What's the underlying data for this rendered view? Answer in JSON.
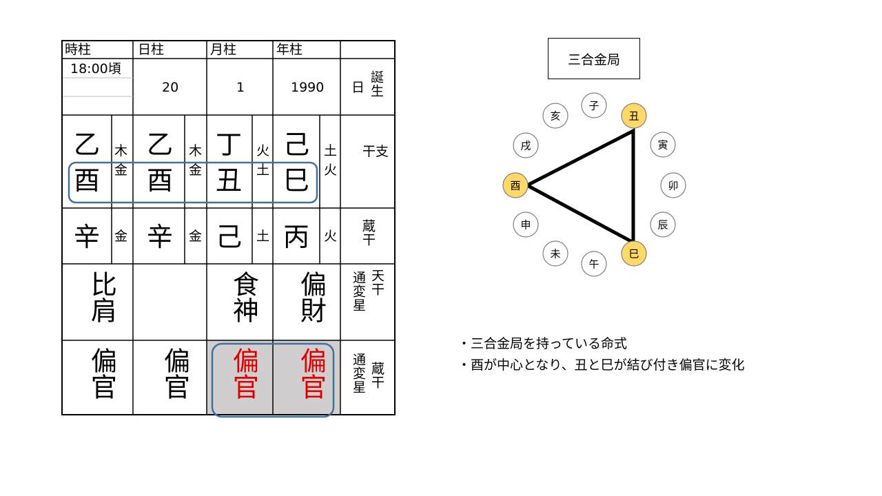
{
  "table": {
    "headers": [
      "時柱",
      "日柱",
      "月柱",
      "年柱"
    ],
    "birth": {
      "time": "18:00頃",
      "day": "20",
      "month": "1",
      "year": "1990",
      "label_a": "日",
      "label_b": "誕生"
    },
    "stems": [
      "乙",
      "乙",
      "丁",
      "己"
    ],
    "stem_elements": [
      "木",
      "木",
      "火",
      "土"
    ],
    "branches": [
      "酉",
      "酉",
      "丑",
      "巳"
    ],
    "branch_elements": [
      "金",
      "金",
      "土",
      "火"
    ],
    "hidden_stems": [
      "辛",
      "辛",
      "己",
      "丙"
    ],
    "hidden_elements": [
      "金",
      "金",
      "土",
      "火"
    ],
    "kanshi_label": "干支",
    "zoukan_label": "蔵干",
    "tenkan_stars": [
      "比肩",
      "",
      "食神",
      "偏財"
    ],
    "tenkan_label_a": "天干",
    "tenkan_label_b": "通変星",
    "zoukan_stars": [
      "偏官",
      "偏官",
      "偏官",
      "偏官"
    ],
    "zoukan_star_label_a": "蔵干",
    "zoukan_star_label_b": "通変星",
    "colors": {
      "highlight_text": "#e00000",
      "highlight_fill": "#d0cece",
      "frame": "#41719c"
    }
  },
  "diagram": {
    "title": "三合金局",
    "branches": [
      "子",
      "丑",
      "寅",
      "卯",
      "辰",
      "巳",
      "午",
      "未",
      "申",
      "酉",
      "戌",
      "亥"
    ],
    "highlighted": [
      "丑",
      "巳",
      "酉"
    ],
    "colors": {
      "highlight": "#ffd966",
      "outline": "#7f7f7f"
    }
  },
  "notes": [
    "・三合金局を持っている命式",
    "・酉が中心となり、丑と巳が結び付き偏官に変化"
  ]
}
